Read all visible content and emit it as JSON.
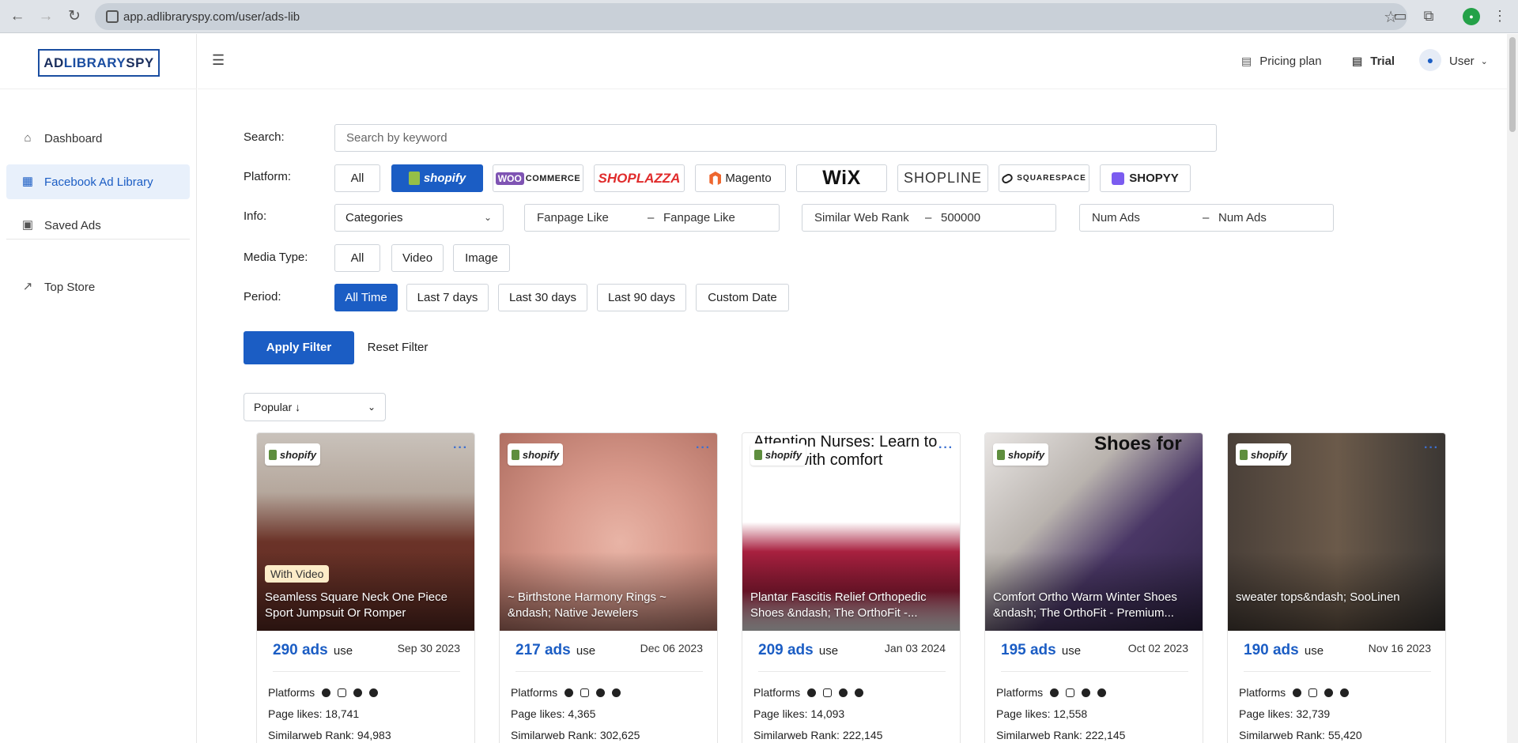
{
  "browser": {
    "url": "app.adlibraryspy.com/user/ads-lib"
  },
  "sidebar": {
    "logo": {
      "part1": "AD",
      "part2": "LIBRARY",
      "part3": "SPY"
    },
    "items": [
      {
        "label": "Dashboard",
        "icon": "home-icon"
      },
      {
        "label": "Facebook Ad Library",
        "icon": "grid-icon",
        "active": true
      },
      {
        "label": "Saved Ads",
        "icon": "save-icon"
      },
      {
        "label": "Top Store",
        "icon": "chart-icon"
      }
    ]
  },
  "header": {
    "pricing": "Pricing plan",
    "trial": "Trial",
    "user": "User"
  },
  "filters": {
    "search_label": "Search:",
    "search_placeholder": "Search by keyword",
    "platform_label": "Platform:",
    "platforms": {
      "all": "All",
      "shopify": "shopify",
      "woo": "WOO",
      "commerce": "COMMERCE",
      "shoplazza": "SHOPLAZZA",
      "magento": "Magento",
      "wix": "WiX",
      "shopline": "SHOPLINE",
      "squarespace": "SQUARESPACE",
      "shopyy": "SHOPYY"
    },
    "info_label": "Info:",
    "categories": "Categories",
    "fanpage_from": "Fanpage Like",
    "fanpage_to": "Fanpage Like",
    "similarweb_from": "Similar Web Rank",
    "similarweb_to": "500000",
    "numads_from": "Num Ads",
    "numads_to": "Num Ads",
    "dash": "–",
    "media_label": "Media Type:",
    "media": [
      "All",
      "Video",
      "Image"
    ],
    "period_label": "Period:",
    "periods": [
      "All Time",
      "Last 7 days",
      "Last 30 days",
      "Last 90 days",
      "Custom Date"
    ],
    "apply": "Apply Filter",
    "reset": "Reset Filter",
    "sort": "Popular ↓"
  },
  "cards": [
    {
      "badge": "shopify",
      "video": "With Video",
      "title": "Seamless Square Neck One Piece Sport Jumpsuit Or Romper",
      "ads": "290 ads",
      "use": "use",
      "date": "Sep 30 2023",
      "platforms": "Platforms",
      "likes": "Page likes: 18,741",
      "rank": "Similarweb Rank: 94,983"
    },
    {
      "badge": "shopify",
      "title": "~ Birthstone Harmony Rings ~ &ndash; Native Jewelers",
      "ads": "217 ads",
      "use": "use",
      "date": "Dec 06 2023",
      "platforms": "Platforms",
      "likes": "Page likes: 4,365",
      "rank": "Similarweb Rank: 302,625"
    },
    {
      "badge": "shopify",
      "headline": "Attention Nurses: Learn to hours with comfort",
      "title": "Plantar Fascitis Relief Orthopedic Shoes &ndash; The OrthoFit -...",
      "ads": "209 ads",
      "use": "use",
      "date": "Jan 03 2024",
      "platforms": "Platforms",
      "likes": "Page likes: 14,093",
      "rank": "Similarweb Rank: 222,145"
    },
    {
      "badge": "shopify",
      "headline": "Shoes for",
      "title": "Comfort Ortho Warm Winter Shoes &ndash; The OrthoFit - Premium...",
      "ads": "195 ads",
      "use": "use",
      "date": "Oct 02 2023",
      "platforms": "Platforms",
      "likes": "Page likes: 12,558",
      "rank": "Similarweb Rank: 222,145"
    },
    {
      "badge": "shopify",
      "title": "sweater tops&ndash; SooLinen",
      "ads": "190 ads",
      "use": "use",
      "date": "Nov 16 2023",
      "platforms": "Platforms",
      "likes": "Page likes: 32,739",
      "rank": "Similarweb Rank: 55,420"
    }
  ],
  "colors": {
    "primary": "#1b5dc4",
    "active_bg": "#e8f0fb"
  }
}
